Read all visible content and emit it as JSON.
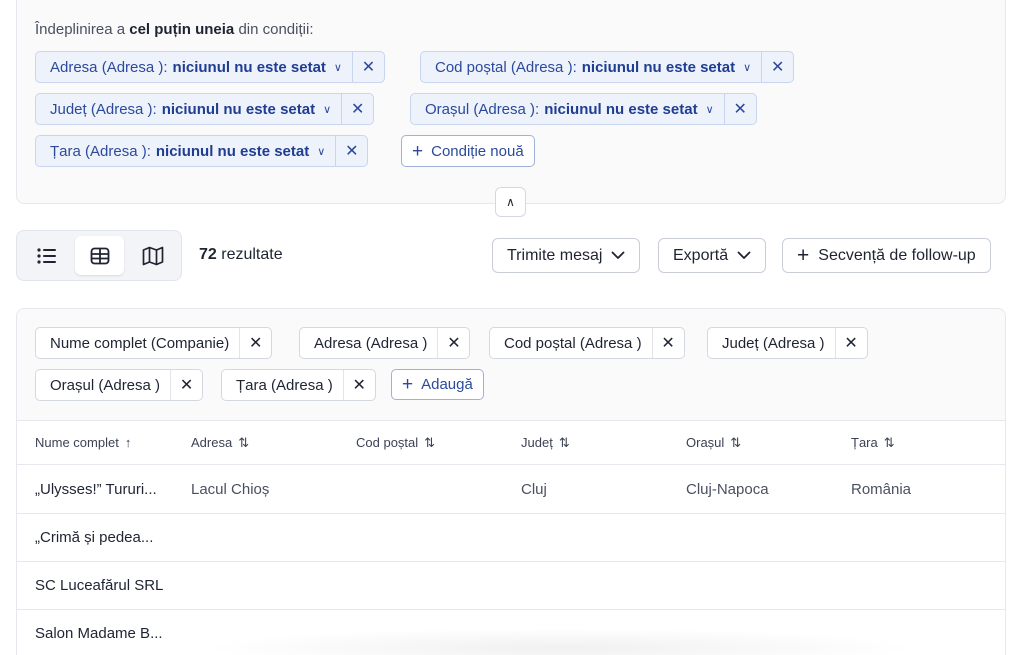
{
  "filters": {
    "intro_prefix": "Îndeplinirea a",
    "intro_bold": "cel puțin uneia",
    "intro_suffix": "din condiții:",
    "chips": [
      {
        "label": "Adresa (Adresa ):",
        "value": "niciunul nu este setat"
      },
      {
        "label": "Cod poștal (Adresa ):",
        "value": "niciunul nu este setat"
      },
      {
        "label": "Județ (Adresa ):",
        "value": "niciunul nu este setat"
      },
      {
        "label": "Orașul (Adresa ):",
        "value": "niciunul nu este setat"
      },
      {
        "label": "Țara (Adresa ):",
        "value": "niciunul nu este setat"
      }
    ],
    "new_condition_label": "Condiție nouă"
  },
  "toolbar": {
    "view_icons": [
      "list-icon",
      "table-icon",
      "map-icon"
    ],
    "active_view": "table",
    "result_count": "72",
    "result_label": "rezultate",
    "send_message_label": "Trimite mesaj",
    "export_label": "Exportă",
    "followup_label": "Secvență de follow-up"
  },
  "columns_bar": {
    "chips": [
      "Nume complet (Companie)",
      "Adresa (Adresa )",
      "Cod poștal (Adresa )",
      "Județ (Adresa )",
      "Orașul (Adresa )",
      "Țara (Adresa )"
    ],
    "add_label": "Adaugă"
  },
  "table": {
    "headers": [
      {
        "label": "Nume complet",
        "sort": "↑"
      },
      {
        "label": "Adresa",
        "sort": "⇅"
      },
      {
        "label": "Cod poștal",
        "sort": "⇅"
      },
      {
        "label": "Județ",
        "sort": "⇅"
      },
      {
        "label": "Orașul",
        "sort": "⇅"
      },
      {
        "label": "Țara",
        "sort": "⇅"
      }
    ],
    "rows": [
      {
        "name": "„Ulysses!” Tururi...",
        "address": "Lacul Chioș",
        "postal": "",
        "county": "Cluj",
        "city": "Cluj-Napoca",
        "country": "România"
      },
      {
        "name": "„Crimă și pedea...",
        "address": "",
        "postal": "",
        "county": "",
        "city": "",
        "country": ""
      },
      {
        "name": "SC Luceafărul SRL",
        "address": "",
        "postal": "",
        "county": "",
        "city": "",
        "country": ""
      },
      {
        "name": "Salon Madame B...",
        "address": "",
        "postal": "",
        "county": "",
        "city": "",
        "country": ""
      }
    ]
  },
  "colors": {
    "accent": "#2b4a9c",
    "chip_bg": "#eef2fb",
    "border": "#e6e8ee"
  }
}
